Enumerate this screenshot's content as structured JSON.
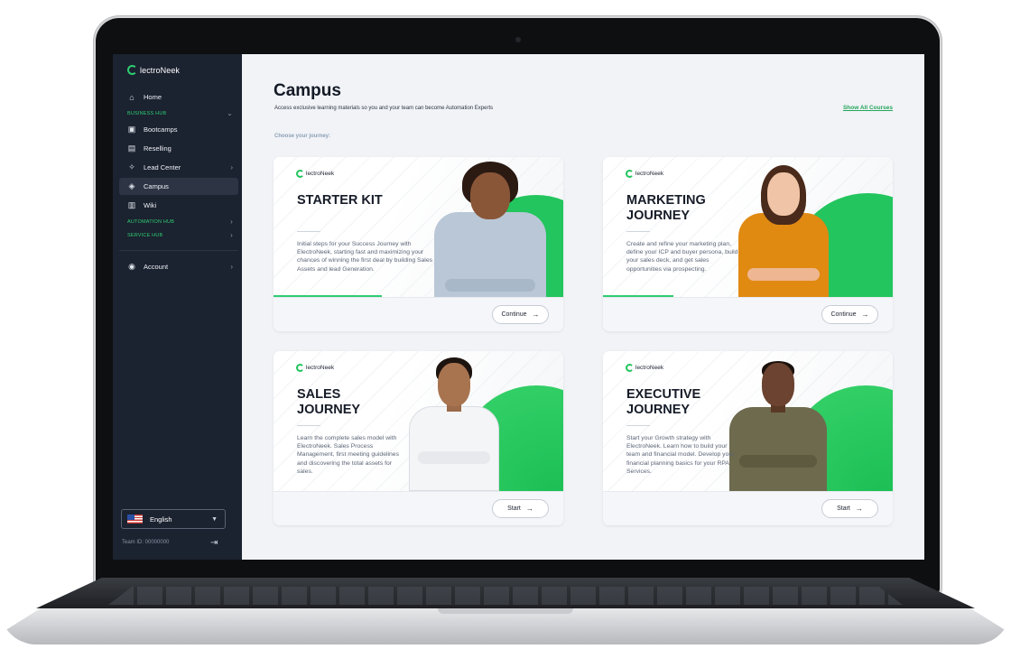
{
  "app": {
    "brand": "lectroNeek"
  },
  "sidebar": {
    "home": "Home",
    "business_hub": "BUSINESS HUB",
    "bootcamps": "Bootcamps",
    "reselling": "Reselling",
    "lead_center": "Lead Center",
    "campus": "Campus",
    "wiki": "Wiki",
    "automation_hub": "AUTOMATION HUB",
    "service_hub": "SERVICE HUB",
    "account": "Account",
    "language": "English",
    "team_id": "Team ID: 00000000"
  },
  "page": {
    "title": "Campus",
    "subtitle": "Access exclusive learning materials so you and your team can become Automation Experts",
    "show_all": "Show All Courses",
    "choose": "Choose your journey:"
  },
  "cards": [
    {
      "brand": "lectroNeek",
      "title": "STARTER KIT",
      "description": "Initial steps for your Success Journey with ElectroNeek, starting fast and maximizing your chances of winning the first deal by building Sales Assets and lead Generation.",
      "button": "Continue"
    },
    {
      "brand": "lectroNeek",
      "title": "MARKETING JOURNEY",
      "description": "Create and refine your marketing plan, define your ICP and buyer persona, build your sales deck, and get sales opportunities via prospecting.",
      "button": "Continue"
    },
    {
      "brand": "lectroNeek",
      "title": "SALES JOURNEY",
      "description": "Learn the complete sales model with ElectroNeek. Sales Process Management, first meeting guidelines and discovering the total assets for sales.",
      "button": "Start"
    },
    {
      "brand": "lectroNeek",
      "title": "EXECUTIVE JOURNEY",
      "description": "Start your Growth strategy with ElectroNeek. Learn how to build your team and financial model. Develop your financial planning basics for your RPA Services.",
      "button": "Start"
    }
  ],
  "colors": {
    "accent": "#22c55e",
    "sidebar_bg": "#1b2230",
    "page_bg": "#f1f3f7"
  },
  "icons": {
    "home": "home-icon",
    "bootcamps": "calendar-icon",
    "reselling": "document-icon",
    "lead_center": "sparkle-cursor-icon",
    "campus": "graduation-cap-icon",
    "wiki": "book-icon",
    "account": "user-circle-icon",
    "logout": "logout-icon",
    "arrow": "arrow-right-icon"
  }
}
